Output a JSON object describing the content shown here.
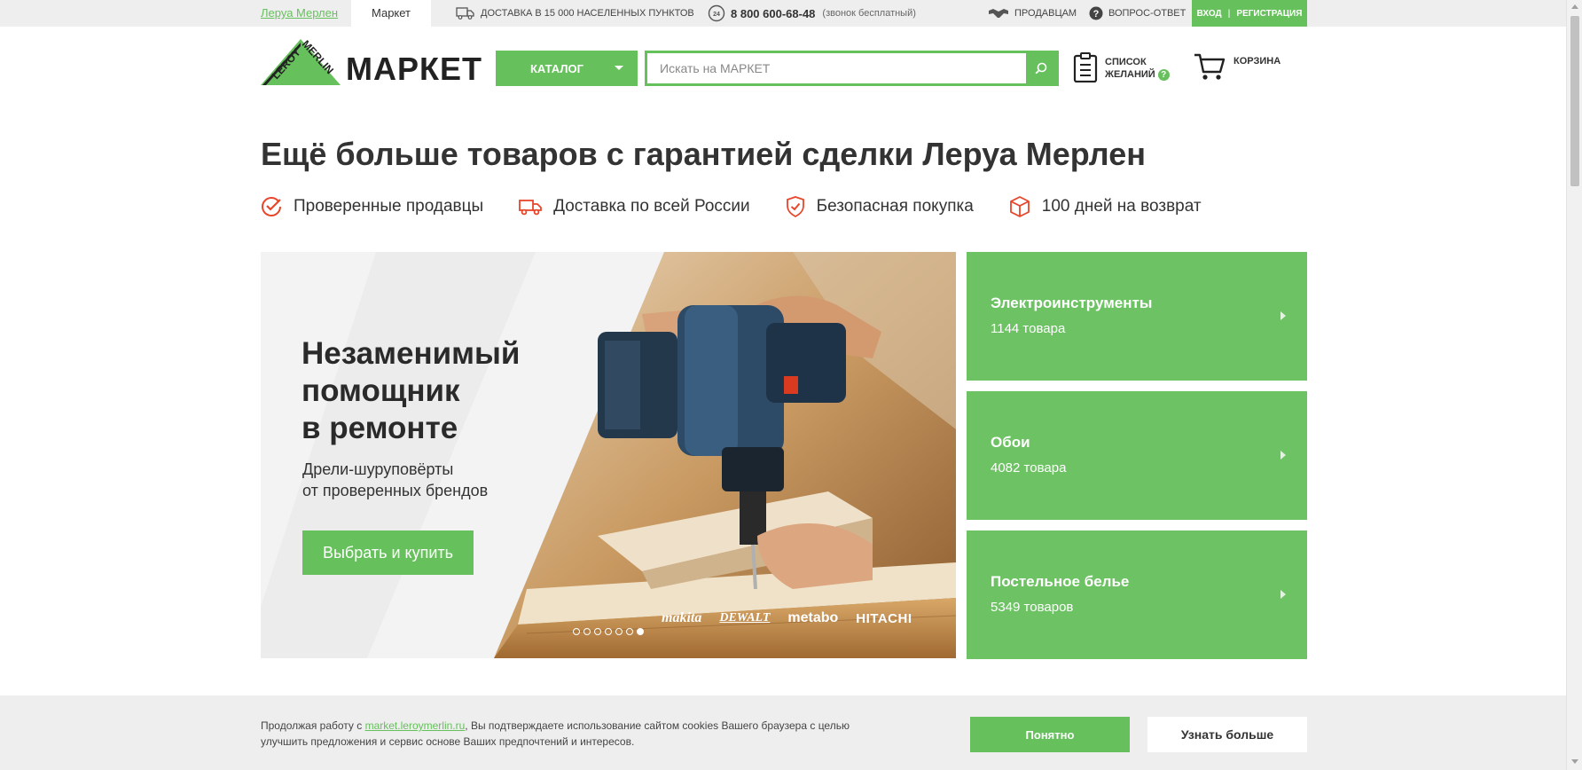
{
  "topbar": {
    "tab_leroy": "Леруа Мерлен",
    "tab_market": "Маркет",
    "delivery": "ДОСТАВКА В 15 000 НАСЕЛЕННЫХ ПУНКТОВ",
    "phone": "8 800 600-68-48",
    "phone_note": "(звонок бесплатный)",
    "sellers": "ПРОДАВЦАМ",
    "faq": "ВОПРОС-ОТВЕТ",
    "login": "ВХОД",
    "register": "РЕГИСТРАЦИЯ",
    "phone_badge": "24"
  },
  "header": {
    "logo_text": "МАРКЕТ",
    "catalog_label": "КАТАЛОГ",
    "search_placeholder": "Искать на МАРКЕТ",
    "wishlist_line1": "СПИСОК",
    "wishlist_line2": "ЖЕЛАНИЙ",
    "wishlist_help": "?",
    "cart_label": "КОРЗИНА"
  },
  "headline": "Ещё больше товаров с гарантией сделки Леруа Мерлен",
  "features": [
    {
      "label": "Проверенные продавцы",
      "icon": "check-circle-icon"
    },
    {
      "label": "Доставка по всей России",
      "icon": "truck-icon"
    },
    {
      "label": "Безопасная покупка",
      "icon": "shield-check-icon"
    },
    {
      "label": "100 дней на возврат",
      "icon": "box-icon"
    }
  ],
  "banner": {
    "title_line1": "Незаменимый",
    "title_line2": "помощник",
    "title_line3": "в ремонте",
    "subtitle_line1": "Дрели-шуруповёрты",
    "subtitle_line2": "от проверенных брендов",
    "button": "Выбрать и купить",
    "brands": [
      "makita",
      "DEWALT",
      "metabo",
      "HITACHI"
    ],
    "active_slide": 7,
    "slide_count": 7
  },
  "categories": [
    {
      "title": "Электроинструменты",
      "count": "1144 товара"
    },
    {
      "title": "Обои",
      "count": "4082 товара"
    },
    {
      "title": "Постельное белье",
      "count": "5349 товаров"
    }
  ],
  "cookie": {
    "text_before": "Продолжая работу с ",
    "link": "market.leroymerlin.ru",
    "text_after": ", Вы подтверждаете использование сайтом cookies Вашего браузера с целью улучшить предложения и сервис  основе Ваших предпочтений и интересов.",
    "accept": "Понятно",
    "more": "Узнать больше"
  },
  "colors": {
    "brand_green": "#66c05c",
    "card_green": "#6dc364",
    "topbar_bg": "#eeeeee",
    "text_dark": "#333333"
  }
}
